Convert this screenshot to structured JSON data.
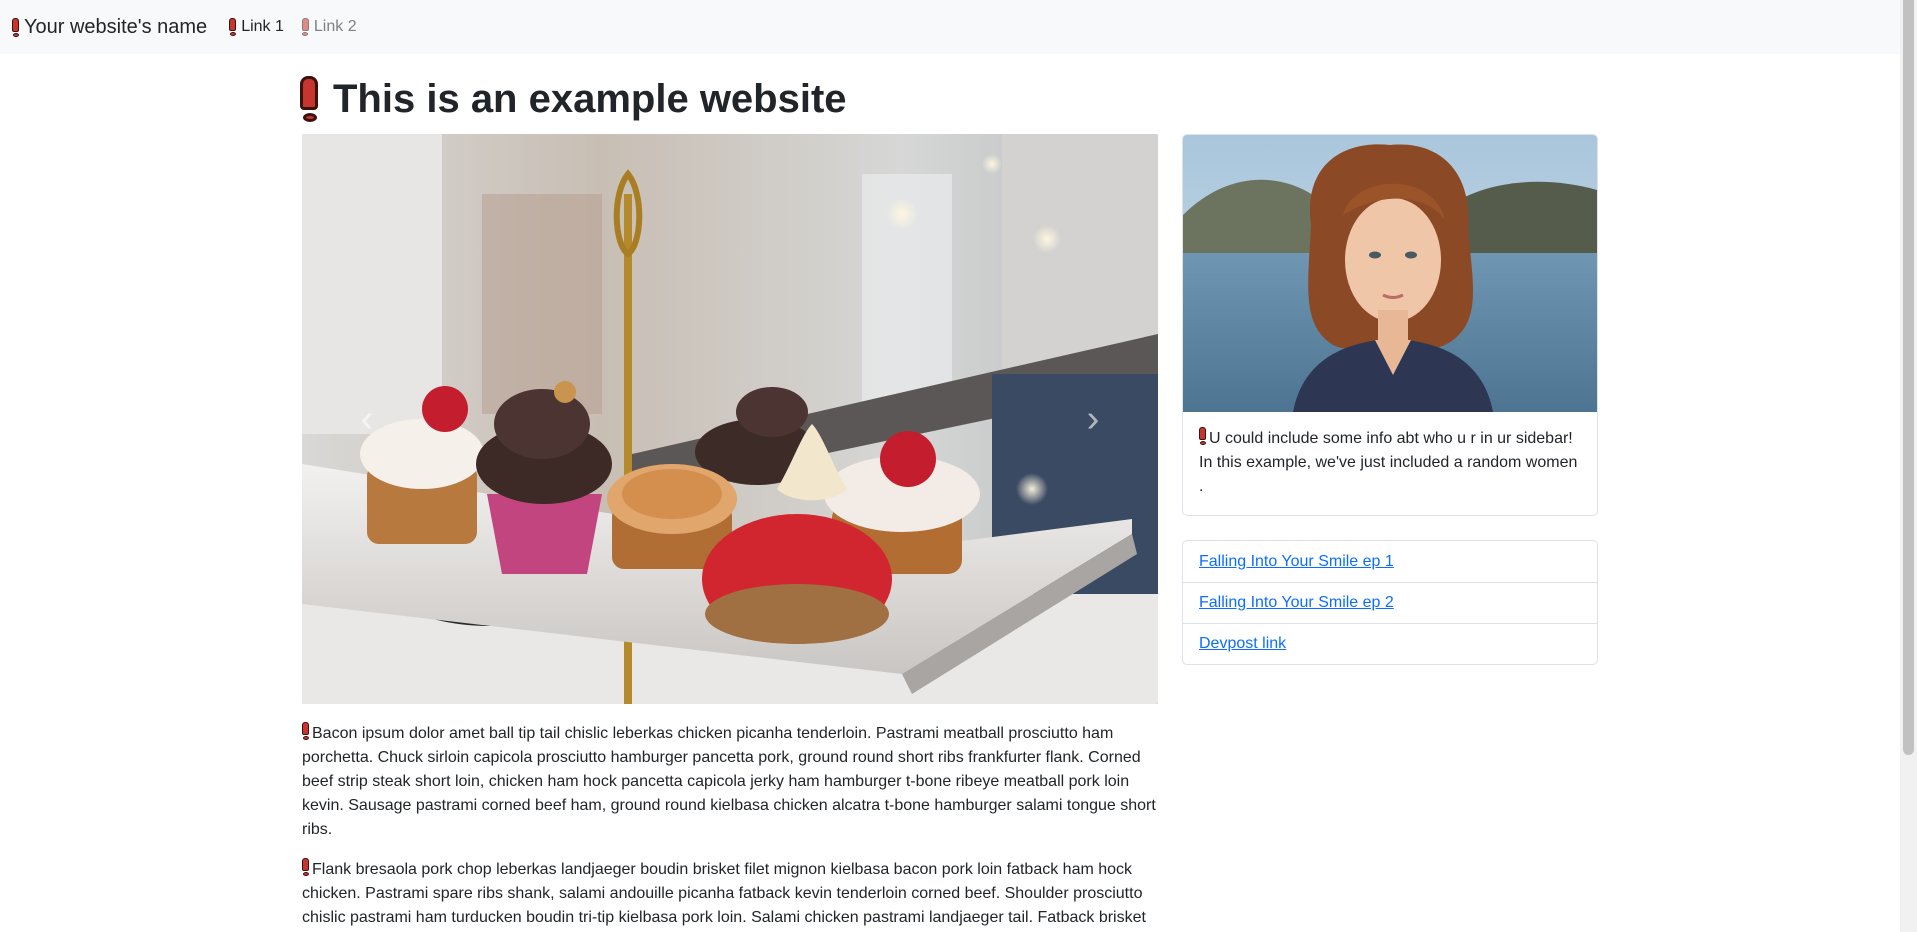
{
  "navbar": {
    "brand": "Your website's name",
    "links": [
      "Link 1",
      "Link 2"
    ]
  },
  "page": {
    "title": "This is an example website"
  },
  "carousel": {
    "prev_icon": "chevron-left-icon",
    "next_icon": "chevron-right-icon",
    "image": "cupcakes-on-tiered-stand-photo"
  },
  "content": {
    "paragraphs": [
      "Bacon ipsum dolor amet ball tip tail chislic leberkas chicken picanha tenderloin. Pastrami meatball prosciutto ham porchetta. Chuck sirloin capicola prosciutto hamburger pancetta pork, ground round short ribs frankfurter flank. Corned beef strip steak short loin, chicken ham hock pancetta capicola jerky ham hamburger t-bone ribeye meatball pork loin kevin. Sausage pastrami corned beef ham, ground round kielbasa chicken alcatra t-bone hamburger salami tongue short ribs.",
      "Flank bresaola pork chop leberkas landjaeger boudin brisket filet mignon kielbasa bacon pork loin fatback ham hock chicken. Pastrami spare ribs shank, salami andouille picanha fatback kevin tenderloin corned beef. Shoulder prosciutto chislic pastrami ham turducken boudin tri-tip kielbasa pork loin. Salami chicken pastrami landjaeger tail. Fatback brisket"
    ]
  },
  "sidebar": {
    "card_image": "portrait-woman-lake-photo",
    "card_text": "U could include some info abt who u r in ur sidebar! In this example, we've just included a random women .",
    "links": [
      "Falling Into Your Smile ep 1",
      "Falling Into Your Smile ep 2",
      "Devpost link"
    ]
  },
  "colors": {
    "emoji_red": "#c6352e",
    "link_blue": "#0d6efd",
    "navbar_bg": "#f8f9fa"
  }
}
